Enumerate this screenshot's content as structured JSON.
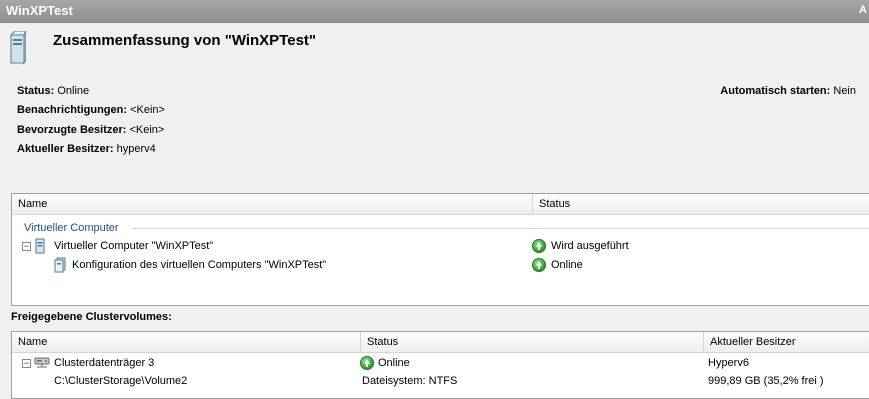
{
  "window": {
    "title": "WinXPTest",
    "right_text": "A"
  },
  "summary": {
    "title": "Zusammenfassung von \"WinXPTest\"",
    "icon": "server-icon",
    "props": {
      "status_label": "Status:",
      "status_value": "Online",
      "notif_label": "Benachrichtigungen:",
      "notif_value": "<Kein>",
      "pref_label": "Bevorzugte Besitzer:",
      "pref_value": "<Kein>",
      "owner_label": "Aktueller Besitzer:",
      "owner_value": "hyperv4",
      "auto_label": "Automatisch starten:",
      "auto_value": "Nein"
    }
  },
  "resources": {
    "columns": [
      "Name",
      "Status"
    ],
    "group": "Virtueller Computer",
    "items": [
      {
        "name": "Virtueller Computer \"WinXPTest\"",
        "status": "Wird ausgeführt",
        "icon": "virtual-machine-icon",
        "status_icon": "online-arrow-icon"
      },
      {
        "name": "Konfiguration des virtuellen Computers \"WinXPTest\"",
        "status": "Online",
        "icon": "vm-configuration-icon",
        "status_icon": "online-arrow-icon"
      }
    ]
  },
  "csv": {
    "section_label": "Freigegebene Clustervolumes:",
    "columns": [
      "Name",
      "Status",
      "Aktueller Besitzer"
    ],
    "row": {
      "name": "Clusterdatenträger 3",
      "status": "Online",
      "owner": "Hyperv6",
      "path": "C:\\ClusterStorage\\Volume2",
      "fs": "Dateisystem: NTFS",
      "size": "999,89 GB (35,2% frei )",
      "icon": "cluster-disk-icon",
      "status_icon": "online-arrow-icon"
    }
  },
  "colors": {
    "group_text": "#1e4e8c",
    "titlebar": "#9a9a9a",
    "ok": "#2d9a2d"
  }
}
